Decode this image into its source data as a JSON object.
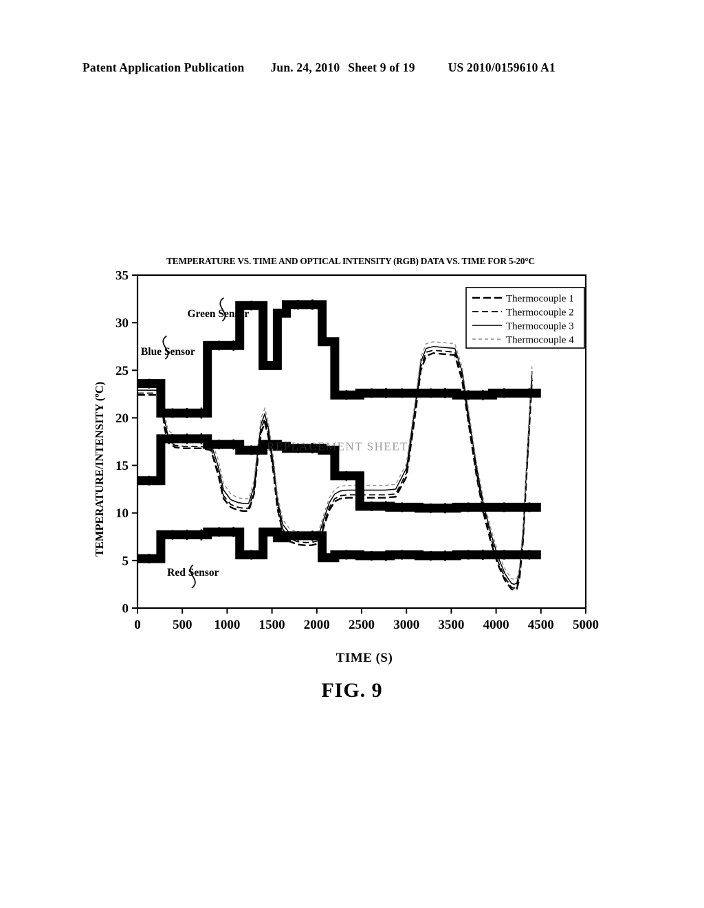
{
  "header": {
    "publication": "Patent Application Publication",
    "date": "Jun. 24, 2010",
    "sheet": "Sheet 9 of 19",
    "doc_number": "US 2010/0159610 A1"
  },
  "figure": {
    "caption": "FIG. 9",
    "watermark": "REPLACEMENT SHEET"
  },
  "chart_data": {
    "type": "line",
    "title": "TEMPERATURE VS. TIME AND OPTICAL INTENSITY (RGB) DATA VS. TIME FOR 5-20°C",
    "xlabel": "TIME (S)",
    "ylabel": "TEMPERATURE/INTENSITY (ºC)",
    "xlim": [
      0,
      5000
    ],
    "ylim": [
      0,
      35
    ],
    "xticks": [
      0,
      500,
      1000,
      1500,
      2000,
      2500,
      3000,
      3500,
      4000,
      4500,
      5000
    ],
    "yticks": [
      0,
      5,
      10,
      15,
      20,
      25,
      30,
      35
    ],
    "grid": false,
    "legend_position": "upper-right",
    "legend": [
      {
        "label": "Thermocouple 1",
        "style": "thick-dashed",
        "color": "#000000"
      },
      {
        "label": "Thermocouple 2",
        "style": "dashed",
        "color": "#000000"
      },
      {
        "label": "Thermocouple 3",
        "style": "solid",
        "color": "#000000"
      },
      {
        "label": "Thermocouple 4",
        "style": "fine-dashed",
        "color": "#8c8c8c"
      }
    ],
    "annotations": [
      {
        "text": "Blue Sensor",
        "x": 340,
        "y": 26.6
      },
      {
        "text": "Green Sensor",
        "x": 900,
        "y": 30.6
      },
      {
        "text": "Red Sensor",
        "x": 620,
        "y": 3.4
      }
    ],
    "series": [
      {
        "name": "Thermocouple 1",
        "style": "thick-dashed",
        "color": "#000000",
        "x": [
          0,
          120,
          260,
          300,
          340,
          420,
          520,
          700,
          820,
          900,
          960,
          1040,
          1120,
          1180,
          1240,
          1300,
          1340,
          1380,
          1420,
          1460,
          1520,
          1560,
          1620,
          1700,
          1780,
          1860,
          1940,
          2020,
          2080,
          2140,
          2200,
          2260,
          2340,
          2420,
          2520,
          2640,
          2760,
          2880,
          3000,
          3100,
          3160,
          3220,
          3300,
          3420,
          3540,
          3620,
          3700,
          3780,
          3860,
          3940,
          4020,
          4100,
          4170,
          4200,
          4230,
          4260,
          4300,
          4340,
          4400
        ],
        "y": [
          22.4,
          22.4,
          22.4,
          19.0,
          17.4,
          16.9,
          16.8,
          16.8,
          16.6,
          14.0,
          11.5,
          10.6,
          10.3,
          10.2,
          10.2,
          12.0,
          15.5,
          18.5,
          19.5,
          18.0,
          14.0,
          10.5,
          8.0,
          7.0,
          6.7,
          6.6,
          6.6,
          6.8,
          8.6,
          10.3,
          11.2,
          11.5,
          11.6,
          11.6,
          11.6,
          11.6,
          11.6,
          11.7,
          13.8,
          20.5,
          25.0,
          26.5,
          26.8,
          26.7,
          26.6,
          24.0,
          19.0,
          14.0,
          10.0,
          7.0,
          4.6,
          2.9,
          2.0,
          1.9,
          2.0,
          3.0,
          7.0,
          14.0,
          24.0
        ]
      },
      {
        "name": "Thermocouple 2",
        "style": "dashed",
        "color": "#000000",
        "x": [
          0,
          120,
          260,
          300,
          340,
          420,
          520,
          700,
          820,
          900,
          960,
          1040,
          1120,
          1180,
          1240,
          1300,
          1340,
          1380,
          1420,
          1460,
          1520,
          1560,
          1620,
          1700,
          1780,
          1860,
          1940,
          2020,
          2080,
          2140,
          2200,
          2260,
          2340,
          2420,
          2520,
          2640,
          2760,
          2880,
          3000,
          3100,
          3160,
          3220,
          3300,
          3420,
          3540,
          3620,
          3700,
          3780,
          3860,
          3940,
          4020,
          4100,
          4170,
          4200,
          4230,
          4260,
          4300,
          4340,
          4400
        ],
        "y": [
          22.6,
          22.6,
          22.6,
          19.4,
          17.6,
          17.1,
          17.0,
          17.0,
          16.8,
          14.3,
          11.8,
          10.9,
          10.6,
          10.5,
          10.5,
          12.3,
          15.9,
          18.9,
          19.9,
          18.4,
          14.4,
          10.9,
          8.3,
          7.3,
          7.0,
          6.9,
          6.9,
          7.1,
          8.9,
          10.6,
          11.5,
          11.8,
          11.9,
          11.9,
          11.9,
          11.9,
          11.9,
          12.0,
          14.2,
          20.9,
          25.4,
          26.9,
          27.1,
          27.0,
          26.9,
          24.4,
          19.4,
          14.4,
          10.4,
          7.4,
          4.9,
          3.2,
          2.2,
          2.1,
          2.2,
          3.3,
          7.4,
          14.4,
          24.4
        ]
      },
      {
        "name": "Thermocouple 3",
        "style": "solid",
        "color": "#000000",
        "x": [
          0,
          120,
          260,
          300,
          340,
          420,
          520,
          700,
          820,
          900,
          960,
          1040,
          1120,
          1180,
          1240,
          1300,
          1340,
          1380,
          1420,
          1460,
          1520,
          1560,
          1620,
          1700,
          1780,
          1860,
          1940,
          2020,
          2080,
          2140,
          2200,
          2260,
          2340,
          2420,
          2520,
          2640,
          2760,
          2880,
          3000,
          3100,
          3160,
          3220,
          3300,
          3420,
          3540,
          3620,
          3700,
          3780,
          3860,
          3940,
          4020,
          4100,
          4170,
          4200,
          4230,
          4260,
          4300,
          4340,
          4400
        ],
        "y": [
          22.9,
          22.9,
          22.9,
          19.9,
          18.1,
          17.6,
          17.5,
          17.5,
          17.3,
          14.9,
          12.4,
          11.4,
          11.1,
          11.0,
          11.0,
          12.8,
          16.4,
          19.4,
          20.4,
          18.9,
          14.9,
          11.4,
          8.8,
          7.8,
          7.5,
          7.4,
          7.4,
          7.6,
          9.4,
          11.1,
          12.0,
          12.3,
          12.4,
          12.4,
          12.4,
          12.4,
          12.4,
          12.5,
          14.7,
          21.4,
          25.9,
          27.3,
          27.5,
          27.4,
          27.3,
          24.9,
          19.9,
          14.9,
          10.9,
          7.9,
          5.4,
          3.6,
          2.6,
          2.5,
          2.6,
          3.7,
          7.9,
          14.9,
          24.9
        ]
      },
      {
        "name": "Thermocouple 4",
        "style": "fine-dashed",
        "color": "#8c8c8c",
        "x": [
          0,
          120,
          260,
          300,
          340,
          420,
          520,
          700,
          820,
          900,
          960,
          1040,
          1120,
          1180,
          1240,
          1300,
          1340,
          1380,
          1420,
          1460,
          1520,
          1560,
          1620,
          1700,
          1780,
          1860,
          1940,
          2020,
          2080,
          2140,
          2200,
          2260,
          2340,
          2420,
          2520,
          2640,
          2760,
          2880,
          3000,
          3100,
          3160,
          3220,
          3300,
          3420,
          3540,
          3620,
          3700,
          3780,
          3860,
          3940,
          4020,
          4100,
          4170,
          4200,
          4230,
          4260,
          4300,
          4340,
          4400
        ],
        "y": [
          23.2,
          23.2,
          23.2,
          20.6,
          18.7,
          18.1,
          17.9,
          17.9,
          17.7,
          15.6,
          13.1,
          12.0,
          11.6,
          11.5,
          11.5,
          13.4,
          17.0,
          20.0,
          21.0,
          19.5,
          15.5,
          12.0,
          9.3,
          8.3,
          8.0,
          7.9,
          7.9,
          8.1,
          9.9,
          11.6,
          12.5,
          12.8,
          12.9,
          12.9,
          12.9,
          12.9,
          12.9,
          13.0,
          15.2,
          21.9,
          26.4,
          27.8,
          28.0,
          27.9,
          27.8,
          25.4,
          20.4,
          15.4,
          11.4,
          8.4,
          5.9,
          4.1,
          3.1,
          3.0,
          3.1,
          4.2,
          8.4,
          15.4,
          25.4
        ]
      },
      {
        "name": "Blue Sensor",
        "style": "thick-step",
        "color": "#000000",
        "x": [
          0,
          260,
          260,
          780,
          780,
          1140,
          1140,
          1400,
          1400,
          1560,
          1560,
          1660,
          1660,
          2060,
          2060,
          2200,
          2200,
          2480,
          2480,
          2820,
          2820,
          3140,
          3140,
          3560,
          3560,
          3960,
          3960,
          4240,
          4240,
          4500
        ],
        "y": [
          23.6,
          23.6,
          20.5,
          20.5,
          27.6,
          27.6,
          31.8,
          31.8,
          25.5,
          25.5,
          31.0,
          31.0,
          31.9,
          31.9,
          28.0,
          28.0,
          22.4,
          22.4,
          22.6,
          22.6,
          22.6,
          22.6,
          22.6,
          22.6,
          22.4,
          22.4,
          22.6,
          22.6,
          22.6,
          22.6
        ]
      },
      {
        "name": "Green Sensor",
        "style": "thick-step",
        "color": "#000000",
        "x": [
          0,
          260,
          260,
          780,
          780,
          1140,
          1140,
          1400,
          1400,
          1560,
          1560,
          1660,
          1660,
          2060,
          2060,
          2200,
          2200,
          2480,
          2480,
          2820,
          2820,
          3140,
          3140,
          3560,
          3560,
          3960,
          3960,
          4240,
          4240,
          4500
        ],
        "y": [
          13.4,
          13.4,
          17.8,
          17.8,
          17.2,
          17.2,
          16.6,
          16.6,
          17.2,
          17.2,
          17.0,
          17.0,
          16.8,
          16.8,
          16.6,
          16.6,
          13.9,
          13.9,
          10.7,
          10.7,
          10.6,
          10.6,
          10.5,
          10.5,
          10.6,
          10.6,
          10.6,
          10.6,
          10.6,
          10.6
        ]
      },
      {
        "name": "Red Sensor",
        "style": "thick-step",
        "color": "#000000",
        "x": [
          0,
          260,
          260,
          780,
          780,
          1140,
          1140,
          1400,
          1400,
          1560,
          1560,
          1660,
          1660,
          2060,
          2060,
          2200,
          2200,
          2480,
          2480,
          2820,
          2820,
          3140,
          3140,
          3560,
          3560,
          3960,
          3960,
          4240,
          4240,
          4500
        ],
        "y": [
          5.2,
          5.2,
          7.7,
          7.7,
          8.0,
          8.0,
          5.6,
          5.6,
          8.0,
          8.0,
          7.4,
          7.4,
          7.6,
          7.6,
          5.3,
          5.3,
          5.6,
          5.6,
          5.5,
          5.5,
          5.6,
          5.6,
          5.5,
          5.5,
          5.6,
          5.6,
          5.6,
          5.6,
          5.6,
          5.6
        ]
      }
    ]
  }
}
